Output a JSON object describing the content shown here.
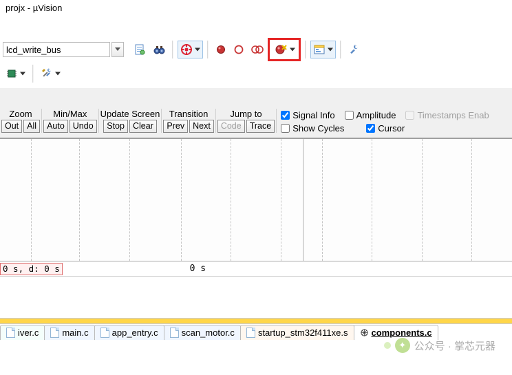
{
  "window": {
    "title": "projx - µVision"
  },
  "toolbar": {
    "search_value": "lcd_write_bus"
  },
  "controls": {
    "zoom": {
      "label": "Zoom",
      "out": "Out",
      "all": "All"
    },
    "minmax": {
      "label": "Min/Max",
      "auto": "Auto",
      "undo": "Undo"
    },
    "update": {
      "label": "Update Screen",
      "stop": "Stop",
      "clear": "Clear"
    },
    "transition": {
      "label": "Transition",
      "prev": "Prev",
      "next": "Next"
    },
    "jump": {
      "label": "Jump to",
      "code": "Code",
      "trace": "Trace"
    }
  },
  "checks": {
    "signal_info": "Signal Info",
    "show_cycles": "Show Cycles",
    "amplitude": "Amplitude",
    "cursor": "Cursor",
    "timestamps": "Timestamps Enab"
  },
  "timebar": {
    "left": "0 s,  d: 0 s",
    "mid": "0 s"
  },
  "tabs": [
    {
      "label": "iver.c"
    },
    {
      "label": "main.c"
    },
    {
      "label": "app_entry.c"
    },
    {
      "label": "scan_motor.c"
    },
    {
      "label": "startup_stm32f411xe.s"
    },
    {
      "label": "components.c"
    }
  ],
  "watermark": {
    "text": "公众号 · 掌芯元器"
  }
}
